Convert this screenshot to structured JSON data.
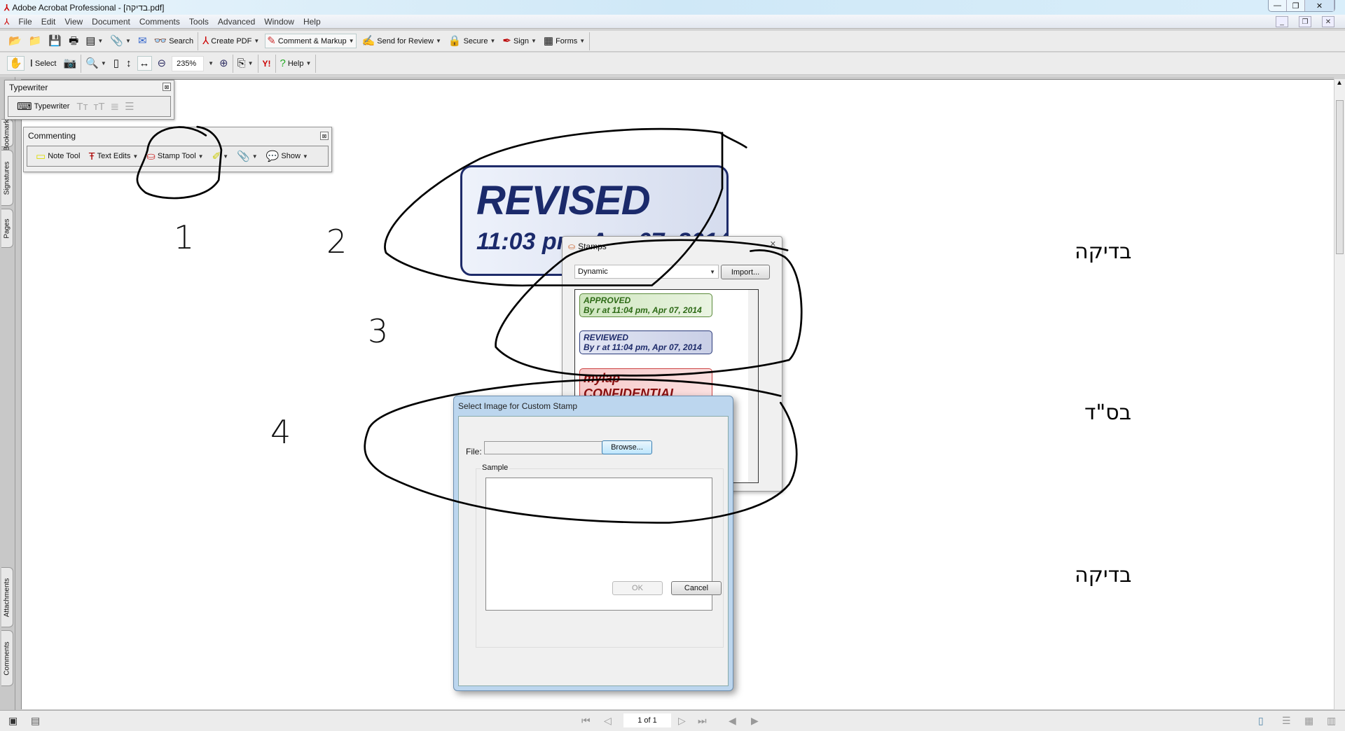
{
  "window": {
    "title": "Adobe Acrobat Professional - [בדיקה.pdf]",
    "controls": [
      "—",
      "❐",
      "✕"
    ]
  },
  "menu": [
    "File",
    "Edit",
    "View",
    "Document",
    "Comments",
    "Tools",
    "Advanced",
    "Window",
    "Help"
  ],
  "toolbar1": {
    "search": "Search",
    "create_pdf": "Create PDF",
    "comment_markup": "Comment & Markup",
    "send_review": "Send for Review",
    "secure": "Secure",
    "sign": "Sign",
    "forms": "Forms"
  },
  "toolbar2": {
    "select": "Select",
    "zoom": "235%",
    "help": "Help"
  },
  "nav_tabs": [
    "Bookmarks",
    "Signatures",
    "Pages",
    "Attachments",
    "Comments"
  ],
  "typewriter_panel": {
    "title": "Typewriter",
    "tool": "Typewriter"
  },
  "commenting_panel": {
    "title": "Commenting",
    "note": "Note Tool",
    "text_edits": "Text Edits",
    "stamp": "Stamp Tool",
    "show": "Show"
  },
  "document": {
    "lines": [
      "בדיקה",
      "בס\"ד",
      "בדיקה"
    ],
    "stamp": {
      "title": "REVISED",
      "subtitle": "11:03 pm, Apr 07, 2014"
    }
  },
  "ink_annotations": [
    "1",
    "2",
    "3",
    "4"
  ],
  "stamps_dialog": {
    "title": "Stamps",
    "category": "Dynamic",
    "import": "Import...",
    "stamps": [
      {
        "title": "APPROVED",
        "by": "By r at 11:04 pm, Apr 07, 2014"
      },
      {
        "title": "REVIEWED",
        "by": "By r at 11:04 pm, Apr 07, 2014"
      },
      {
        "title": "mylap",
        "by": "CONFIDENTIAL"
      }
    ]
  },
  "custom_dialog": {
    "title": "Select Image for Custom Stamp",
    "file_label": "File:",
    "file_value": "",
    "browse": "Browse...",
    "sample": "Sample",
    "ok": "OK",
    "cancel": "Cancel"
  },
  "statusbar": {
    "page": "1 of 1"
  }
}
